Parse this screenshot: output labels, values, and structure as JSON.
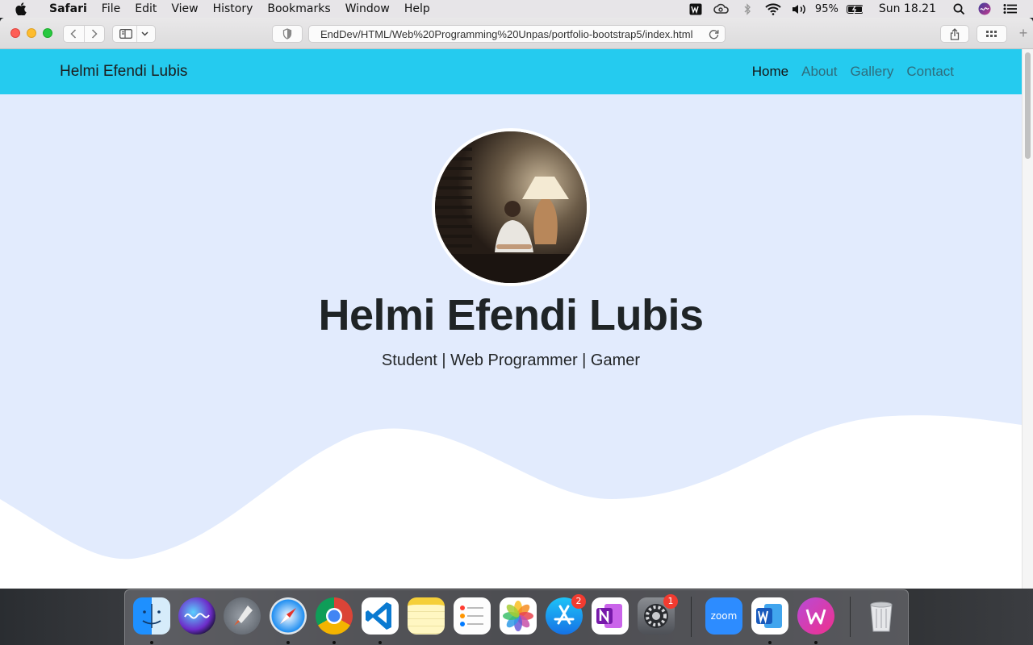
{
  "menubar": {
    "app_name": "Safari",
    "items": [
      "File",
      "Edit",
      "View",
      "History",
      "Bookmarks",
      "Window",
      "Help"
    ],
    "battery_percent": "95%",
    "clock": "Sun 18.21"
  },
  "browser": {
    "url": "EndDev/HTML/Web%20Programming%20Unpas/portfolio-bootstrap5/index.html"
  },
  "site": {
    "brand": "Helmi Efendi Lubis",
    "nav": [
      "Home",
      "About",
      "Gallery",
      "Contact"
    ],
    "active_nav": "Home",
    "hero_name": "Helmi Efendi Lubis",
    "hero_tagline": "Student | Web Programmer | Gamer",
    "colors": {
      "navbar": "#25cbef",
      "hero_bg": "#e2ebfd",
      "wave": "#ffffff"
    }
  },
  "dock": {
    "apps": [
      "Finder",
      "Siri",
      "Launchpad",
      "Safari",
      "Chrome",
      "Visual Studio Code",
      "Notes",
      "Reminders",
      "Photos",
      "App Store",
      "OneNote",
      "System Preferences",
      "Zoom",
      "Word",
      "WPS Office",
      "Trash"
    ],
    "badges": {
      "app_store": "2",
      "system_preferences": "1"
    },
    "zoom_label": "zoom"
  }
}
